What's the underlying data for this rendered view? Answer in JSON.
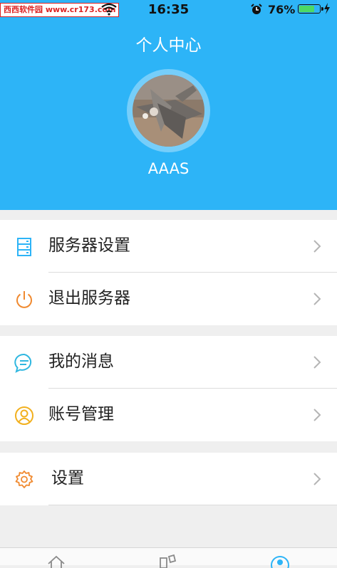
{
  "status_bar": {
    "watermark": "西西软件园 www.cr173.com",
    "time": "16:35",
    "battery_percent": "76%",
    "battery_level": 0.76
  },
  "header": {
    "title": "个人中心",
    "username": "AAAS"
  },
  "menu": {
    "server_settings": "服务器设置",
    "logout_server": "退出服务器",
    "my_messages": "我的消息",
    "account_management": "账号管理",
    "settings": "设置"
  },
  "colors": {
    "header_bg": "#2db4f7",
    "server_icon": "#2db4f7",
    "power_icon": "#f08a30",
    "message_icon": "#2fb7e0",
    "account_icon": "#f2b01e",
    "settings_icon": "#f08a30"
  },
  "icons": {
    "server": "server-icon",
    "power": "power-icon",
    "message": "message-icon",
    "account": "user-circle-icon",
    "settings": "gear-icon",
    "chevron": "chevron-right-icon"
  }
}
